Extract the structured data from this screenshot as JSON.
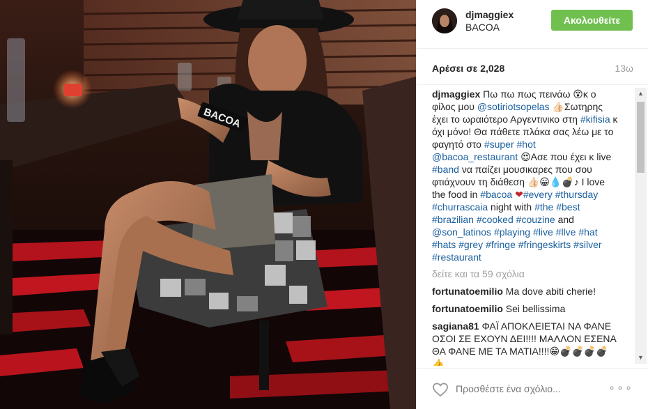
{
  "post": {
    "username": "djmaggiex",
    "location": "BACOA",
    "follow_label": "Ακολουθείτε",
    "likes": "Αρέσει σε 2,028",
    "time": "13ω",
    "more_label": "∘∘∘",
    "add_comment_placeholder": "Προσθέστε ένα σχόλιο...",
    "view_all": "δείτε και τα 59 σχόλια",
    "photo_sign": "BACOA"
  },
  "caption": {
    "user": "djmaggiex",
    "text_1": " Πω πω πως πεινάω 😵κ ο φίλος μου ",
    "mention_1": "@sotiriotsopelas",
    "text_2": " 👍🏻Σωτηρης έχει το ωραιότερο Αργεντινικο στη ",
    "tag_kifisia": "#kifisia",
    "text_3": " κ όχι μόνο! Θα πάθετε πλάκα σας λέω με το φαγητό στο ",
    "tag_super": "#super",
    "tag_hot": "#hot",
    "mention_bacoa": "@bacoa_restaurant",
    "text_4": " 😍Ασε που έχει κ live ",
    "tag_band": "#band",
    "text_5": " να παίζει μουσικαρες που σου φτιάχνουν τη διάθεση 👍🏻😀💧💣♪ I love the food in ",
    "tag_bacoa": "#bacoa",
    "text_6": " ❤",
    "tag_every": "#every",
    "tag_thursday": "#thursday",
    "tag_churrascaia": "#churrascaia",
    "text_7": " night with ",
    "tag_the": "#the",
    "tag_best": "#best",
    "tag_brazilian": "#brazilian",
    "tag_cooked": "#cooked",
    "tag_couzine": "#couzine",
    "text_8": " and ",
    "mention_latinos": "@son_latinos",
    "tag_playing": "#playing",
    "tag_live": "#live",
    "tag_llve": "#llve",
    "tag_hat": "#hat",
    "tag_hats": "#hats",
    "tag_grey": "#grey",
    "tag_fringe": "#fringe",
    "tag_fringeskirts": "#fringeskirts",
    "tag_silver": "#silver",
    "tag_restaurant": "#restaurant"
  },
  "comments": [
    {
      "user": "fortunatoemilio",
      "text": " Ma dove abiti cherie!"
    },
    {
      "user": "fortunatoemilio",
      "text": " Sei bellissima"
    },
    {
      "user": "sagiana81",
      "text": " ΦΑΪ ΑΠΟΚΛΕΙΕΤΑΙ ΝΑ ΦΑΝΕ ΟΣΟΙ ΣΕ ΕΧΟΥΝ ΔΕΙ!!!! ΜΑΛΛΟΝ ΕΣΕΝΑ ΘΑ ΦΑΝΕ ΜΕ ΤΑ ΜΑΤΙΑ!!!!😁💣💣💣💣👍"
    }
  ],
  "colors": {
    "follow_button": "#70c050",
    "link": "#1a5f9e",
    "muted": "#a0a0a0"
  },
  "icons": {
    "heart": "heart-outline-icon",
    "more": "more-options-icon",
    "scroll_up": "scroll-up-arrow-icon",
    "scroll_down": "scroll-down-arrow-icon"
  }
}
